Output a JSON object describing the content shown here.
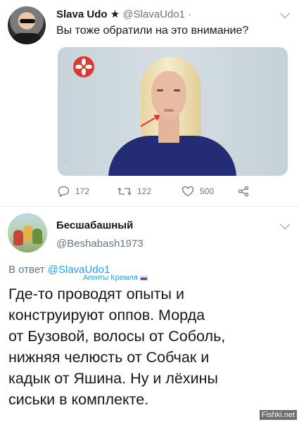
{
  "tweet": {
    "author_name": "Slava Udo",
    "star": "★",
    "handle": "@SlavaUdo1",
    "separator": "·",
    "text": "Вы тоже обратили на это внимание?",
    "stats": {
      "replies": "172",
      "retweets": "122",
      "likes": "500"
    }
  },
  "reply": {
    "author_name": "Бесшабашный",
    "handle": "@Beshabash1973",
    "replying_prefix": "В ответ",
    "replying_mention": "@SlavaUdo1",
    "overlay_label": "Агенты Кремля",
    "lines": [
      "Где-то проводят опыты и",
      "конструируют оппов. Морда",
      "от Бузовой, волосы от Соболь,",
      "нижняя челюсть от Собчак и",
      "кадык от Яшина. Ну и лёхины",
      "сиськи в комплекте."
    ]
  },
  "watermark": "Fishki.net",
  "colors": {
    "text": "#14171a",
    "secondary": "#657786",
    "link": "#1da1f2",
    "divider": "#e6ecf0"
  }
}
